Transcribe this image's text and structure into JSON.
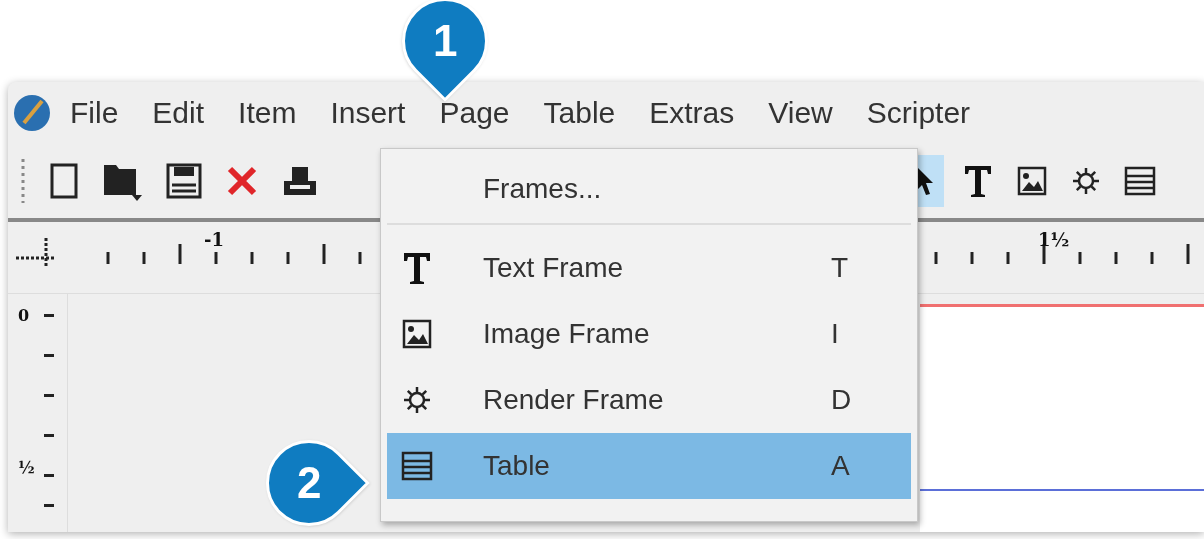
{
  "callouts": [
    {
      "label": "1"
    },
    {
      "label": "2"
    }
  ],
  "menubar": [
    {
      "label": "File"
    },
    {
      "label": "Edit"
    },
    {
      "label": "Item"
    },
    {
      "label": "Insert"
    },
    {
      "label": "Page"
    },
    {
      "label": "Table"
    },
    {
      "label": "Extras"
    },
    {
      "label": "View"
    },
    {
      "label": "Scripter"
    }
  ],
  "toolbar": {
    "tools": [
      {
        "selected": true
      },
      {
        "selected": false
      },
      {
        "selected": false
      },
      {
        "selected": false
      },
      {
        "selected": false
      }
    ]
  },
  "horizontal_ruler": {
    "labels": [
      "-1",
      "1½"
    ]
  },
  "vertical_ruler": {
    "labels": [
      "0",
      "½"
    ]
  },
  "insert_menu": {
    "header_item": {
      "label": "Frames..."
    },
    "items": [
      {
        "label": "Text Frame",
        "shortcut": "T",
        "selected": false
      },
      {
        "label": "Image Frame",
        "shortcut": "I",
        "selected": false
      },
      {
        "label": "Render Frame",
        "shortcut": "D",
        "selected": false
      },
      {
        "label": "Table",
        "shortcut": "A",
        "selected": true
      }
    ]
  }
}
